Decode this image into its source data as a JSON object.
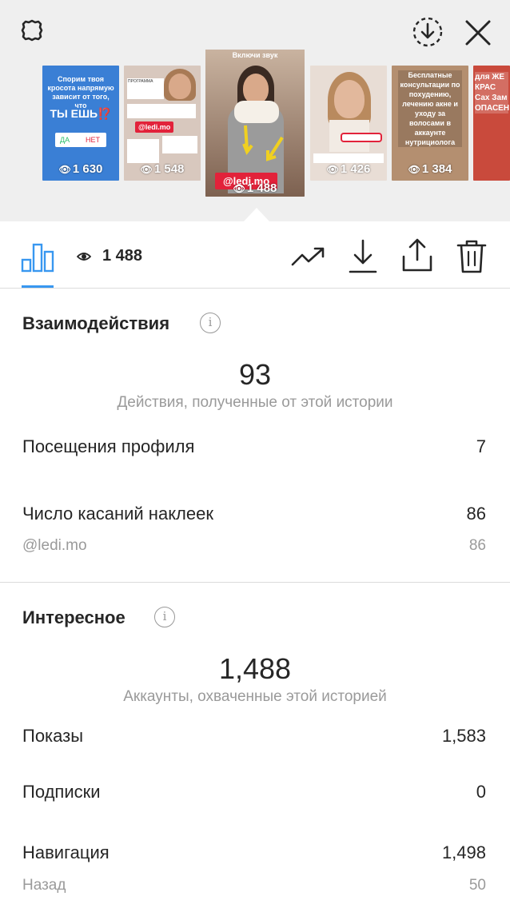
{
  "header": {
    "thumbnails": [
      {
        "views": "1 630",
        "line1": "Спорим твоя",
        "line2": "кросота напрямую",
        "line3": "зависит от того,",
        "line4": "что",
        "line5": "ТЫ ЕШЬ",
        "q": "⁉️",
        "yes": "ДА",
        "no": "НЕТ",
        "bg": "#3a7fd5"
      },
      {
        "views": "1 548",
        "tag": "@ledi.mo",
        "bg": "#d8c8be"
      },
      {
        "views": "1 488",
        "banner": "Включи звук",
        "tag": "@ledi.mo",
        "bg": "#8a6a55"
      },
      {
        "views": "1 426",
        "bg": "#e8ddd5"
      },
      {
        "views": "1 384",
        "text": "Бесплатные консультации по похудению, лечению акне и уходу за волосами в аккаунте нутрициолога",
        "bg": "#b48f70"
      },
      {
        "views": "",
        "text": "для ЖЕ КРАС Сах Зам ОПАСЕН",
        "bg": "#e44a3a"
      }
    ]
  },
  "toolbar": {
    "view_count": "1 488"
  },
  "interactions": {
    "title": "Взаимодействия",
    "total": "93",
    "caption": "Действия, полученные от этой истории",
    "profile_visits_label": "Посещения профиля",
    "profile_visits_value": "7",
    "sticker_taps_label": "Число касаний наклеек",
    "sticker_taps_value": "86",
    "sticker_name": "@ledi.mo",
    "sticker_value": "86"
  },
  "discovery": {
    "title": "Интересное",
    "total": "1,488",
    "caption": "Аккаунты, охваченные этой историей",
    "impressions_label": "Показы",
    "impressions_value": "1,583",
    "follows_label": "Подписки",
    "follows_value": "0",
    "navigation_label": "Навигация",
    "navigation_value": "1,498",
    "back_label": "Назад",
    "back_value": "50"
  },
  "colors": {
    "accent": "#3897f0",
    "top_bg": "#efefef",
    "muted": "#9a9a9a"
  }
}
